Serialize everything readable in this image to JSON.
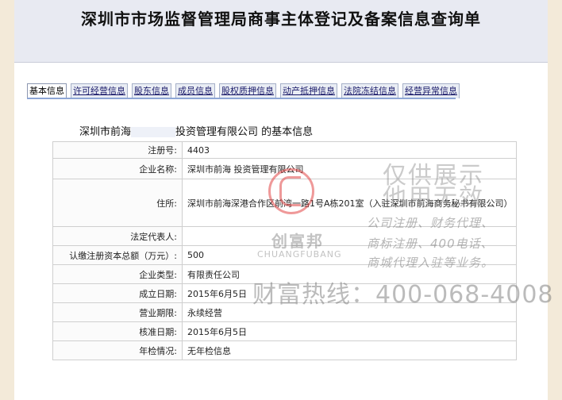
{
  "page": {
    "title": "深圳市市场监督管理局商事主体登记及备案信息查询单"
  },
  "tabs": [
    {
      "label": "基本信息",
      "active": true
    },
    {
      "label": "许可经营信息"
    },
    {
      "label": "股东信息"
    },
    {
      "label": "成员信息"
    },
    {
      "label": "股权质押信息"
    },
    {
      "label": "动产抵押信息"
    },
    {
      "label": "法院冻结信息"
    },
    {
      "label": "经营异常信息"
    }
  ],
  "heading": {
    "prefix": "深圳市前海",
    "middle": "投资管理有限公司",
    "suffix": " 的基本信息"
  },
  "info_rows": [
    {
      "label": "注册号:",
      "value": "4403"
    },
    {
      "label": "企业名称:",
      "value": "深圳市前海   投资管理有限公司"
    },
    {
      "label": "住所:",
      "value": "深圳市前海深港合作区前湾一路1号A栋201室（入驻深圳市前海商务秘书有限公司）"
    },
    {
      "label": "法定代表人:",
      "value": ""
    },
    {
      "label": "认缴注册资本总额（万元）:",
      "value": "500"
    },
    {
      "label": "企业类型:",
      "value": "有限责任公司"
    },
    {
      "label": "成立日期:",
      "value": "2015年6月5日"
    },
    {
      "label": "营业期限:",
      "value": "永续经营"
    },
    {
      "label": "核准日期:",
      "value": "2015年6月5日"
    },
    {
      "label": "年检情况:",
      "value": "无年检信息"
    }
  ],
  "watermark": {
    "brand_cn": "创富邦",
    "brand_en": "CHUANGFUBANG",
    "notice_line1": "仅供展示",
    "notice_line2": "他用无效",
    "service_line1": "公司注册、财务代理、",
    "service_line2": "商标注册、400电话、",
    "service_line3": "商城代理入驻等业务。",
    "hotline": "财富热线：400-068-4008"
  },
  "colors": {
    "background": "#f3ead9",
    "tab_rule": "#8ea6d6",
    "watermark_red": "#e14646"
  }
}
